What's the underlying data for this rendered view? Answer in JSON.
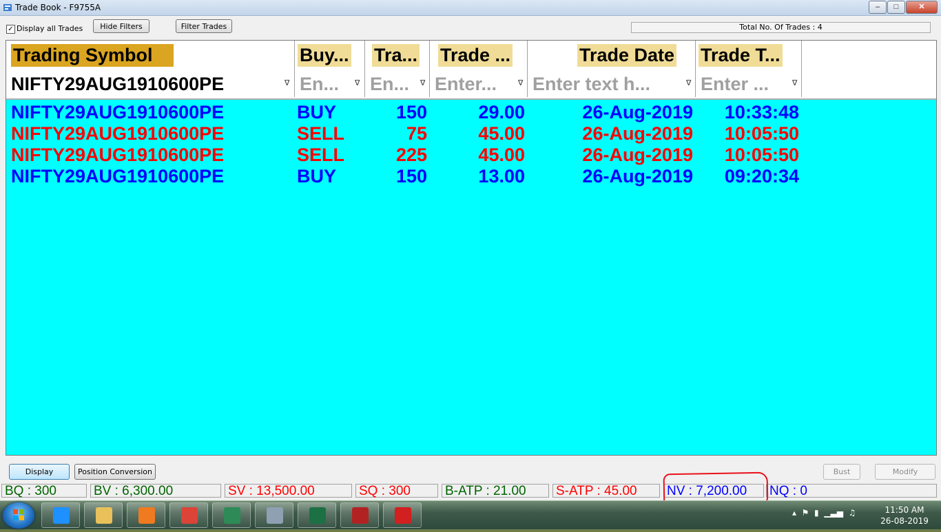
{
  "window": {
    "title": "Trade Book - F9755A",
    "min": "–",
    "max": "□",
    "close": "✕"
  },
  "toolbar": {
    "display_all_label": "Display all Trades",
    "display_all_checked": "✓",
    "hide_filters_label": "Hide Filters",
    "filter_trades_label": "Filter Trades",
    "total_trades": "Total No. Of Trades : 4"
  },
  "grid": {
    "columns": [
      "Trading Symbol",
      "Buy...",
      "Tra...",
      "Trade ...",
      "Trade Date",
      "Trade T..."
    ],
    "filters": [
      "NIFTY29AUG1910600PE",
      "En...",
      "En...",
      "Enter...",
      "Enter text h...",
      "Enter ..."
    ],
    "filter_icon": "funnel-icon",
    "rows": [
      {
        "symbol": "NIFTY29AUG1910600PE",
        "side": "BUY",
        "qty": "150",
        "price": "29.00",
        "date": "26-Aug-2019",
        "time": "10:33:48",
        "color": "#0000ff"
      },
      {
        "symbol": "NIFTY29AUG1910600PE",
        "side": "SELL",
        "qty": "75",
        "price": "45.00",
        "date": "26-Aug-2019",
        "time": "10:05:50",
        "color": "#ff0000"
      },
      {
        "symbol": "NIFTY29AUG1910600PE",
        "side": "SELL",
        "qty": "225",
        "price": "45.00",
        "date": "26-Aug-2019",
        "time": "10:05:50",
        "color": "#ff0000"
      },
      {
        "symbol": "NIFTY29AUG1910600PE",
        "side": "BUY",
        "qty": "150",
        "price": "13.00",
        "date": "26-Aug-2019",
        "time": "09:20:34",
        "color": "#0000ff"
      }
    ],
    "background": "#00ffff"
  },
  "buttons": {
    "display": "Display",
    "position_conversion": "Position Conversion",
    "bust": "Bust",
    "modify": "Modify"
  },
  "status": {
    "bq": "BQ : 300",
    "bv": "BV : 6,300.00",
    "sv": "SV : 13,500.00",
    "sq": "SQ : 300",
    "batp": "B-ATP : 21.00",
    "satp": "S-ATP : 45.00",
    "nv": "NV : 7,200.00",
    "nq": "NQ : 0",
    "buy_color": "#006400",
    "sell_color": "#ff0000",
    "net_color": "#0000ff"
  },
  "taskbar": {
    "apps": [
      "ie-icon",
      "explorer-icon",
      "media-player-icon",
      "chrome-icon",
      "trading-app-icon",
      "calculator-icon",
      "excel-icon",
      "mail-icon",
      "pdf-icon"
    ],
    "time": "11:50 AM",
    "date": "26-08-2019"
  }
}
